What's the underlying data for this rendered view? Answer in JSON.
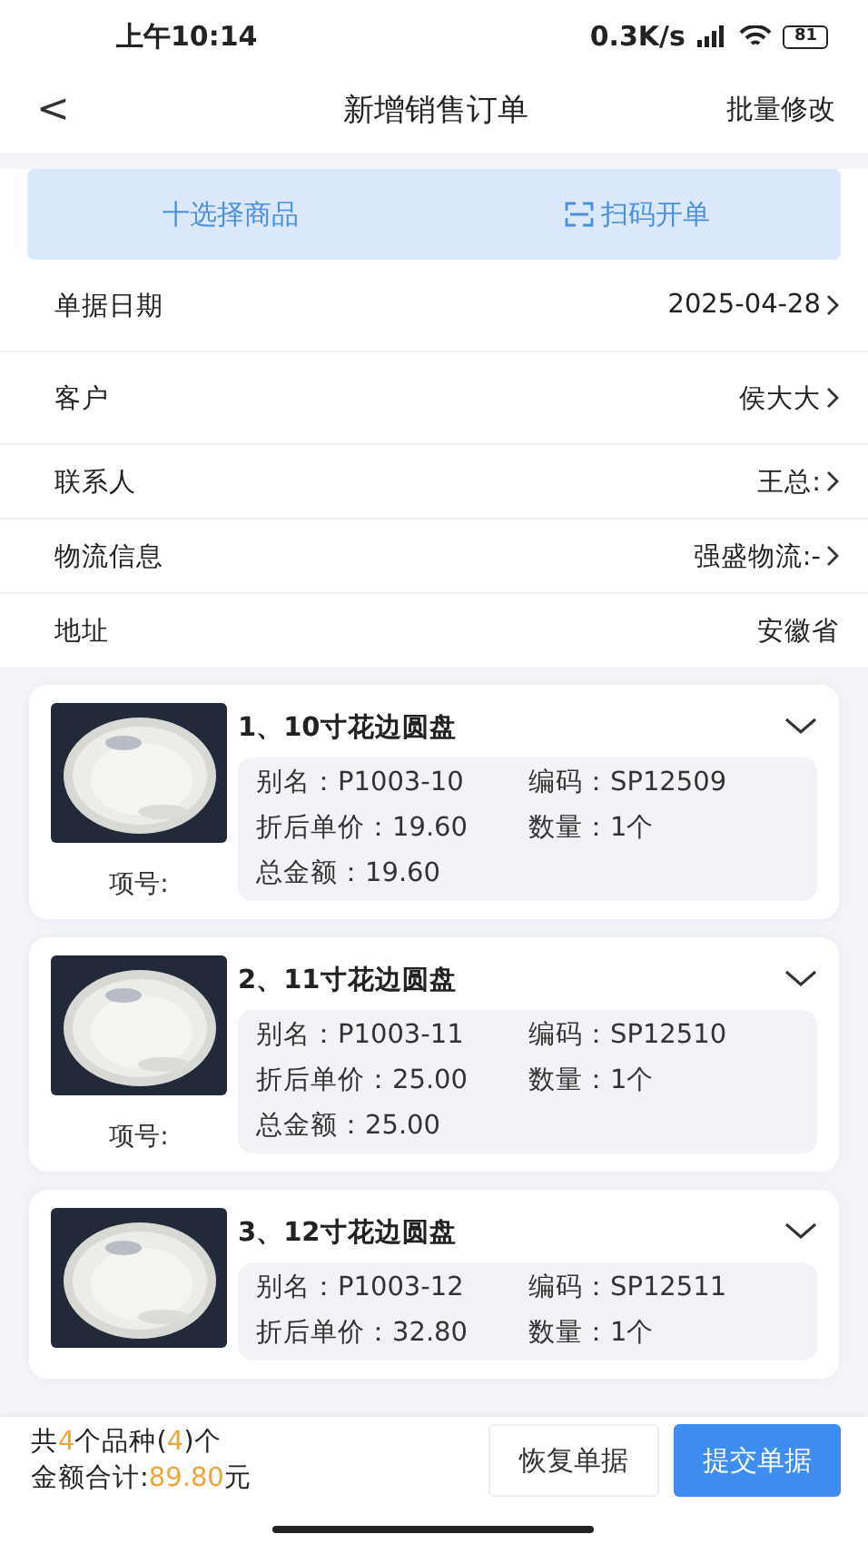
{
  "status_bar": {
    "time": "上午10:14",
    "network_speed": "0.3K/s",
    "battery": "81"
  },
  "nav": {
    "back": "<",
    "title": "新增销售订单",
    "action": "批量修改"
  },
  "actions": [
    {
      "kind": "add",
      "label": "十选择商品"
    },
    {
      "kind": "scan",
      "label": "扫码开单"
    }
  ],
  "form": [
    {
      "label": "单据日期",
      "value": "2025-04-28",
      "arrow": true
    },
    {
      "label": "客户",
      "value": "侯大大",
      "arrow": true
    },
    {
      "label": "联系人",
      "value": "王总:",
      "arrow": true
    },
    {
      "label": "物流信息",
      "value": "强盛物流:-",
      "arrow": true
    },
    {
      "label": "地址",
      "value": "安徽省",
      "arrow": false
    }
  ],
  "items": [
    {
      "title": "1、10寸花边圆盘",
      "alias": "别名：P1003-10",
      "code": "编码：SP12509",
      "price": "折后单价：19.60",
      "qty": "数量：1个",
      "total": "总金额：19.60",
      "index_label": "项号:"
    },
    {
      "title": "2、11寸花边圆盘",
      "alias": "别名：P1003-11",
      "code": "编码：SP12510",
      "price": "折后单价：25.00",
      "qty": "数量：1个",
      "total": "总金额：25.00",
      "index_label": "项号:"
    },
    {
      "title": "3、12寸花边圆盘",
      "alias": "别名：P1003-12",
      "code": "编码：SP12511",
      "price": "折后单价：32.80",
      "qty": "数量：1个"
    }
  ],
  "footer": {
    "count_prefix": "共",
    "kinds": "4",
    "count_middle": "个品种(",
    "units": "4",
    "count_suffix": ")个",
    "amount_label": "金额合计:",
    "amount": "89.80",
    "amount_unit": "元",
    "restore": "恢复单据",
    "submit": "提交单据"
  }
}
